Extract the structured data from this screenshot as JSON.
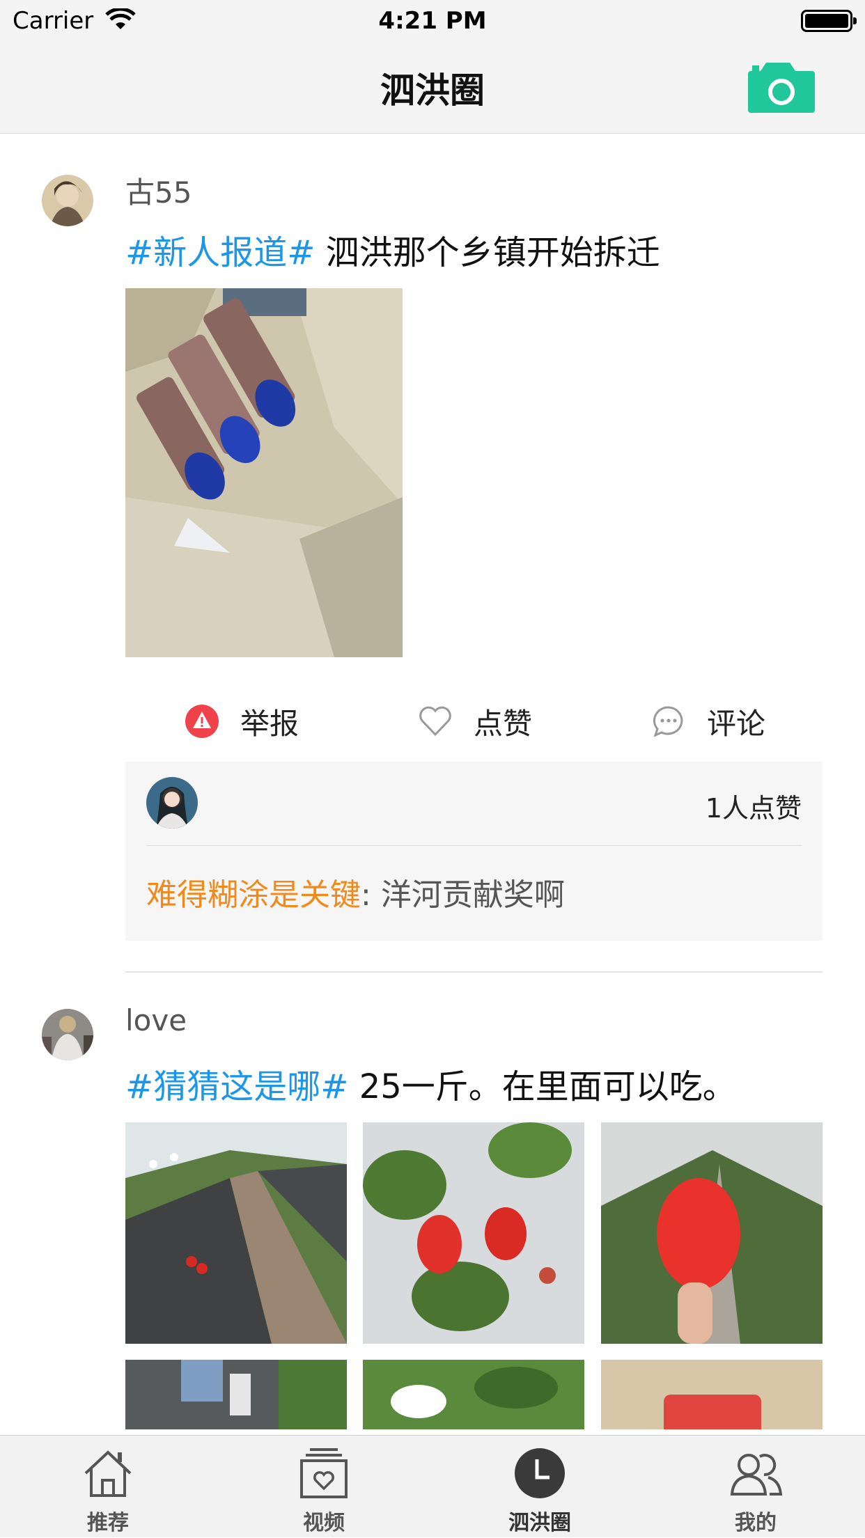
{
  "status_bar": {
    "carrier": "Carrier",
    "time": "4:21 PM"
  },
  "nav": {
    "title": "泗洪圈",
    "camera_icon": "camera-icon",
    "accent": "#1fc79a"
  },
  "posts": [
    {
      "username": "古55",
      "tag": "#新人报道#",
      "text": " 泗洪那个乡镇开始拆迁",
      "actions": {
        "report": "举报",
        "like": "点赞",
        "comment": "评论"
      },
      "like_count": "1人点赞",
      "comment_user": "难得糊涂是关键",
      "comment_sep": ":",
      "comment_text": " 洋河贡献奖啊"
    },
    {
      "username": "love",
      "tag": "#猜猜这是哪#",
      "text": "   25一斤。在里面可以吃。"
    }
  ],
  "tabs": [
    {
      "label": "推荐",
      "icon": "home-icon"
    },
    {
      "label": "视频",
      "icon": "video-icon"
    },
    {
      "label": "泗洪圈",
      "icon": "clock-icon"
    },
    {
      "label": "我的",
      "icon": "user-icon"
    }
  ],
  "colors": {
    "tag": "#1c97e8",
    "commenter": "#f08a1c",
    "report": "#f0424b"
  }
}
